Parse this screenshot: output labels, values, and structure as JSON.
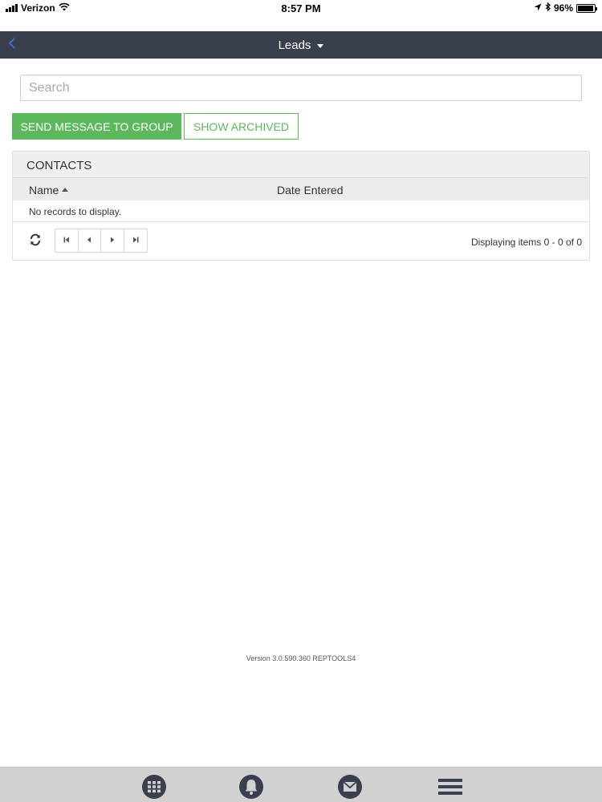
{
  "status_bar": {
    "carrier": "Verizon",
    "time": "8:57 PM",
    "battery": "96%",
    "battery_level": 0.96
  },
  "app_bar": {
    "title": "Leads"
  },
  "search": {
    "placeholder": "Search",
    "value": ""
  },
  "actions": {
    "send_message_label": "SEND MESSAGE TO GROUP",
    "show_archived_label": "SHOW ARCHIVED"
  },
  "contacts_grid": {
    "title": "CONTACTS",
    "columns": [
      "Name",
      "Date Entered"
    ],
    "sorted_column": "Name",
    "empty_message": "No records to display.",
    "pager_info": "Displaying items 0 - 0 of 0"
  },
  "footer": {
    "version": "Version 3.0.590.360 REPTOOLS4"
  },
  "tab_bar": {
    "items": [
      "grid-icon",
      "bell-icon",
      "mail-icon",
      "menu-icon"
    ]
  },
  "colors": {
    "app_bar_bg": "#3a3f4e",
    "accent_green": "#5cb85c",
    "tab_bar_bg": "#d1d1d1",
    "tab_icon": "#3a3f4e"
  }
}
